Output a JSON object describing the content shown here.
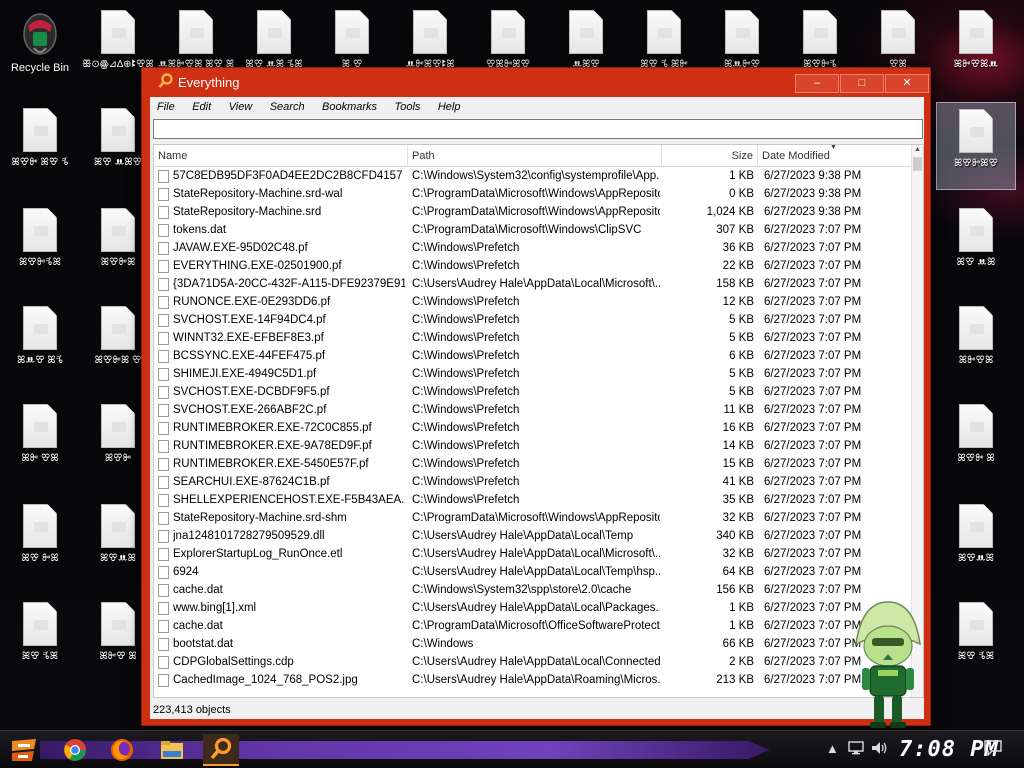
{
  "desktop": {
    "recycle_bin": {
      "label": "Recycle Bin"
    },
    "icons": [
      {
        "label": "ꕥ⊙ꙮ⊿∆⊕ꔪꕢꕤ"
      },
      {
        "label": "ꔚꕤꔻꕢꕤ ꕤꕢ ꕤꔻ"
      },
      {
        "label": "ꕤꕢ ꔚꕤ ꕦꕤ"
      },
      {
        "label": "ꕤ ꕢ"
      },
      {
        "label": "ꔚꔻꕤꕢꔪꕤ"
      },
      {
        "label": "ꕢꕤꔻꕤꕢ"
      },
      {
        "label": "ꔚꕤꕢ"
      },
      {
        "label": "ꕤꕢ ꕦ ꕤꔻ"
      },
      {
        "label": "ꕤꔚꔻꕢ"
      },
      {
        "label": "ꕤꕢꔻꕦ"
      },
      {
        "label": "ꕢꕤ"
      },
      {
        "label": "ꕤꔻꕢꕤꔚ"
      },
      {
        "label": "ꕤꕢꔻ ꕤꕢ ꕦ"
      },
      {
        "label": "ꕤꕢ ꔚꕤꕢ"
      },
      {
        "label": "ꕤꕢꔻꕦꕤ"
      },
      {
        "label": "ꕤꕢꔻꕤ"
      },
      {
        "label": "ꕤꔚꕢ ꕤꕦ"
      },
      {
        "label": "ꕤꕢꔻꕤ ꕢ"
      },
      {
        "label": "ꕤꔻ ꕢꕤ"
      },
      {
        "label": "ꕤꕢꔻ"
      },
      {
        "label": "ꕤꕢ ꔻꕤ"
      },
      {
        "label": "ꕤꕢꔚꕤ"
      },
      {
        "label": "ꕤꕢ ꕦꕤ"
      },
      {
        "label": "ꕤꔻꕢ ꕤ"
      },
      {
        "label": "ꕤꕢꔻꕤꕢ"
      },
      {
        "label": "ꕤꕢ ꔚꕤ"
      },
      {
        "label": "ꕤꔻꕢꕤ"
      },
      {
        "label": "ꕤꕢꔻ ꕤ"
      }
    ]
  },
  "window": {
    "title": "Everything",
    "minimize_glyph": "–",
    "maximize_glyph": "□",
    "close_glyph": "✕",
    "menu": [
      "File",
      "Edit",
      "View",
      "Search",
      "Bookmarks",
      "Tools",
      "Help"
    ],
    "search": {
      "value": "",
      "placeholder": ""
    },
    "columns": {
      "name": "Name",
      "path": "Path",
      "size": "Size",
      "date": "Date Modified"
    },
    "rows": [
      {
        "name": "57C8EDB95DF3F0AD4EE2DC2B8CFD4157",
        "path": "C:\\Windows\\System32\\config\\systemprofile\\App...",
        "size": "1 KB",
        "date": "6/27/2023 9:38 PM"
      },
      {
        "name": "StateRepository-Machine.srd-wal",
        "path": "C:\\ProgramData\\Microsoft\\Windows\\AppRepository",
        "size": "0 KB",
        "date": "6/27/2023 9:38 PM"
      },
      {
        "name": "StateRepository-Machine.srd",
        "path": "C:\\ProgramData\\Microsoft\\Windows\\AppRepository",
        "size": "1,024 KB",
        "date": "6/27/2023 9:38 PM"
      },
      {
        "name": "tokens.dat",
        "path": "C:\\ProgramData\\Microsoft\\Windows\\ClipSVC",
        "size": "307 KB",
        "date": "6/27/2023 7:07 PM"
      },
      {
        "name": "JAVAW.EXE-95D02C48.pf",
        "path": "C:\\Windows\\Prefetch",
        "size": "36 KB",
        "date": "6/27/2023 7:07 PM"
      },
      {
        "name": "EVERYTHING.EXE-02501900.pf",
        "path": "C:\\Windows\\Prefetch",
        "size": "22 KB",
        "date": "6/27/2023 7:07 PM"
      },
      {
        "name": "{3DA71D5A-20CC-432F-A115-DFE92379E91F}...",
        "path": "C:\\Users\\Audrey Hale\\AppData\\Local\\Microsoft\\...",
        "size": "158 KB",
        "date": "6/27/2023 7:07 PM"
      },
      {
        "name": "RUNONCE.EXE-0E293DD6.pf",
        "path": "C:\\Windows\\Prefetch",
        "size": "12 KB",
        "date": "6/27/2023 7:07 PM"
      },
      {
        "name": "SVCHOST.EXE-14F94DC4.pf",
        "path": "C:\\Windows\\Prefetch",
        "size": "5 KB",
        "date": "6/27/2023 7:07 PM"
      },
      {
        "name": "WINNT32.EXE-EFBEF8E3.pf",
        "path": "C:\\Windows\\Prefetch",
        "size": "5 KB",
        "date": "6/27/2023 7:07 PM"
      },
      {
        "name": "BCSSYNC.EXE-44FEF475.pf",
        "path": "C:\\Windows\\Prefetch",
        "size": "6 KB",
        "date": "6/27/2023 7:07 PM"
      },
      {
        "name": "SHIMEJI.EXE-4949C5D1.pf",
        "path": "C:\\Windows\\Prefetch",
        "size": "5 KB",
        "date": "6/27/2023 7:07 PM"
      },
      {
        "name": "SVCHOST.EXE-DCBDF9F5.pf",
        "path": "C:\\Windows\\Prefetch",
        "size": "5 KB",
        "date": "6/27/2023 7:07 PM"
      },
      {
        "name": "SVCHOST.EXE-266ABF2C.pf",
        "path": "C:\\Windows\\Prefetch",
        "size": "11 KB",
        "date": "6/27/2023 7:07 PM"
      },
      {
        "name": "RUNTIMEBROKER.EXE-72C0C855.pf",
        "path": "C:\\Windows\\Prefetch",
        "size": "16 KB",
        "date": "6/27/2023 7:07 PM"
      },
      {
        "name": "RUNTIMEBROKER.EXE-9A78ED9F.pf",
        "path": "C:\\Windows\\Prefetch",
        "size": "14 KB",
        "date": "6/27/2023 7:07 PM"
      },
      {
        "name": "RUNTIMEBROKER.EXE-5450E57F.pf",
        "path": "C:\\Windows\\Prefetch",
        "size": "15 KB",
        "date": "6/27/2023 7:07 PM"
      },
      {
        "name": "SEARCHUI.EXE-87624C1B.pf",
        "path": "C:\\Windows\\Prefetch",
        "size": "41 KB",
        "date": "6/27/2023 7:07 PM"
      },
      {
        "name": "SHELLEXPERIENCEHOST.EXE-F5B43AEA.pf",
        "path": "C:\\Windows\\Prefetch",
        "size": "35 KB",
        "date": "6/27/2023 7:07 PM"
      },
      {
        "name": "StateRepository-Machine.srd-shm",
        "path": "C:\\ProgramData\\Microsoft\\Windows\\AppRepository",
        "size": "32 KB",
        "date": "6/27/2023 7:07 PM"
      },
      {
        "name": "jna1248101728279509529.dll",
        "path": "C:\\Users\\Audrey Hale\\AppData\\Local\\Temp",
        "size": "340 KB",
        "date": "6/27/2023 7:07 PM"
      },
      {
        "name": "ExplorerStartupLog_RunOnce.etl",
        "path": "C:\\Users\\Audrey Hale\\AppData\\Local\\Microsoft\\...",
        "size": "32 KB",
        "date": "6/27/2023 7:07 PM"
      },
      {
        "name": "6924",
        "path": "C:\\Users\\Audrey Hale\\AppData\\Local\\Temp\\hsp...",
        "size": "64 KB",
        "date": "6/27/2023 7:07 PM"
      },
      {
        "name": "cache.dat",
        "path": "C:\\Windows\\System32\\spp\\store\\2.0\\cache",
        "size": "156 KB",
        "date": "6/27/2023 7:07 PM"
      },
      {
        "name": "www.bing[1].xml",
        "path": "C:\\Users\\Audrey Hale\\AppData\\Local\\Packages...",
        "size": "1 KB",
        "date": "6/27/2023 7:07 PM"
      },
      {
        "name": "cache.dat",
        "path": "C:\\ProgramData\\Microsoft\\OfficeSoftwareProtecti...",
        "size": "1 KB",
        "date": "6/27/2023 7:07 PM"
      },
      {
        "name": "bootstat.dat",
        "path": "C:\\Windows",
        "size": "66 KB",
        "date": "6/27/2023 7:07 PM"
      },
      {
        "name": "CDPGlobalSettings.cdp",
        "path": "C:\\Users\\Audrey Hale\\AppData\\Local\\Connected...",
        "size": "2 KB",
        "date": "6/27/2023 7:07 PM"
      },
      {
        "name": "CachedImage_1024_768_POS2.jpg",
        "path": "C:\\Users\\Audrey Hale\\AppData\\Roaming\\Micros...",
        "size": "213 KB",
        "date": "6/27/2023 7:07 PM"
      }
    ],
    "status": "223,413 objects"
  },
  "taskbar": {
    "clock": "7:08 PM"
  },
  "colors": {
    "window_frame": "#cf2f12",
    "accent_purple": "#6a3ab8",
    "firefox_orange": "#f0a030"
  }
}
